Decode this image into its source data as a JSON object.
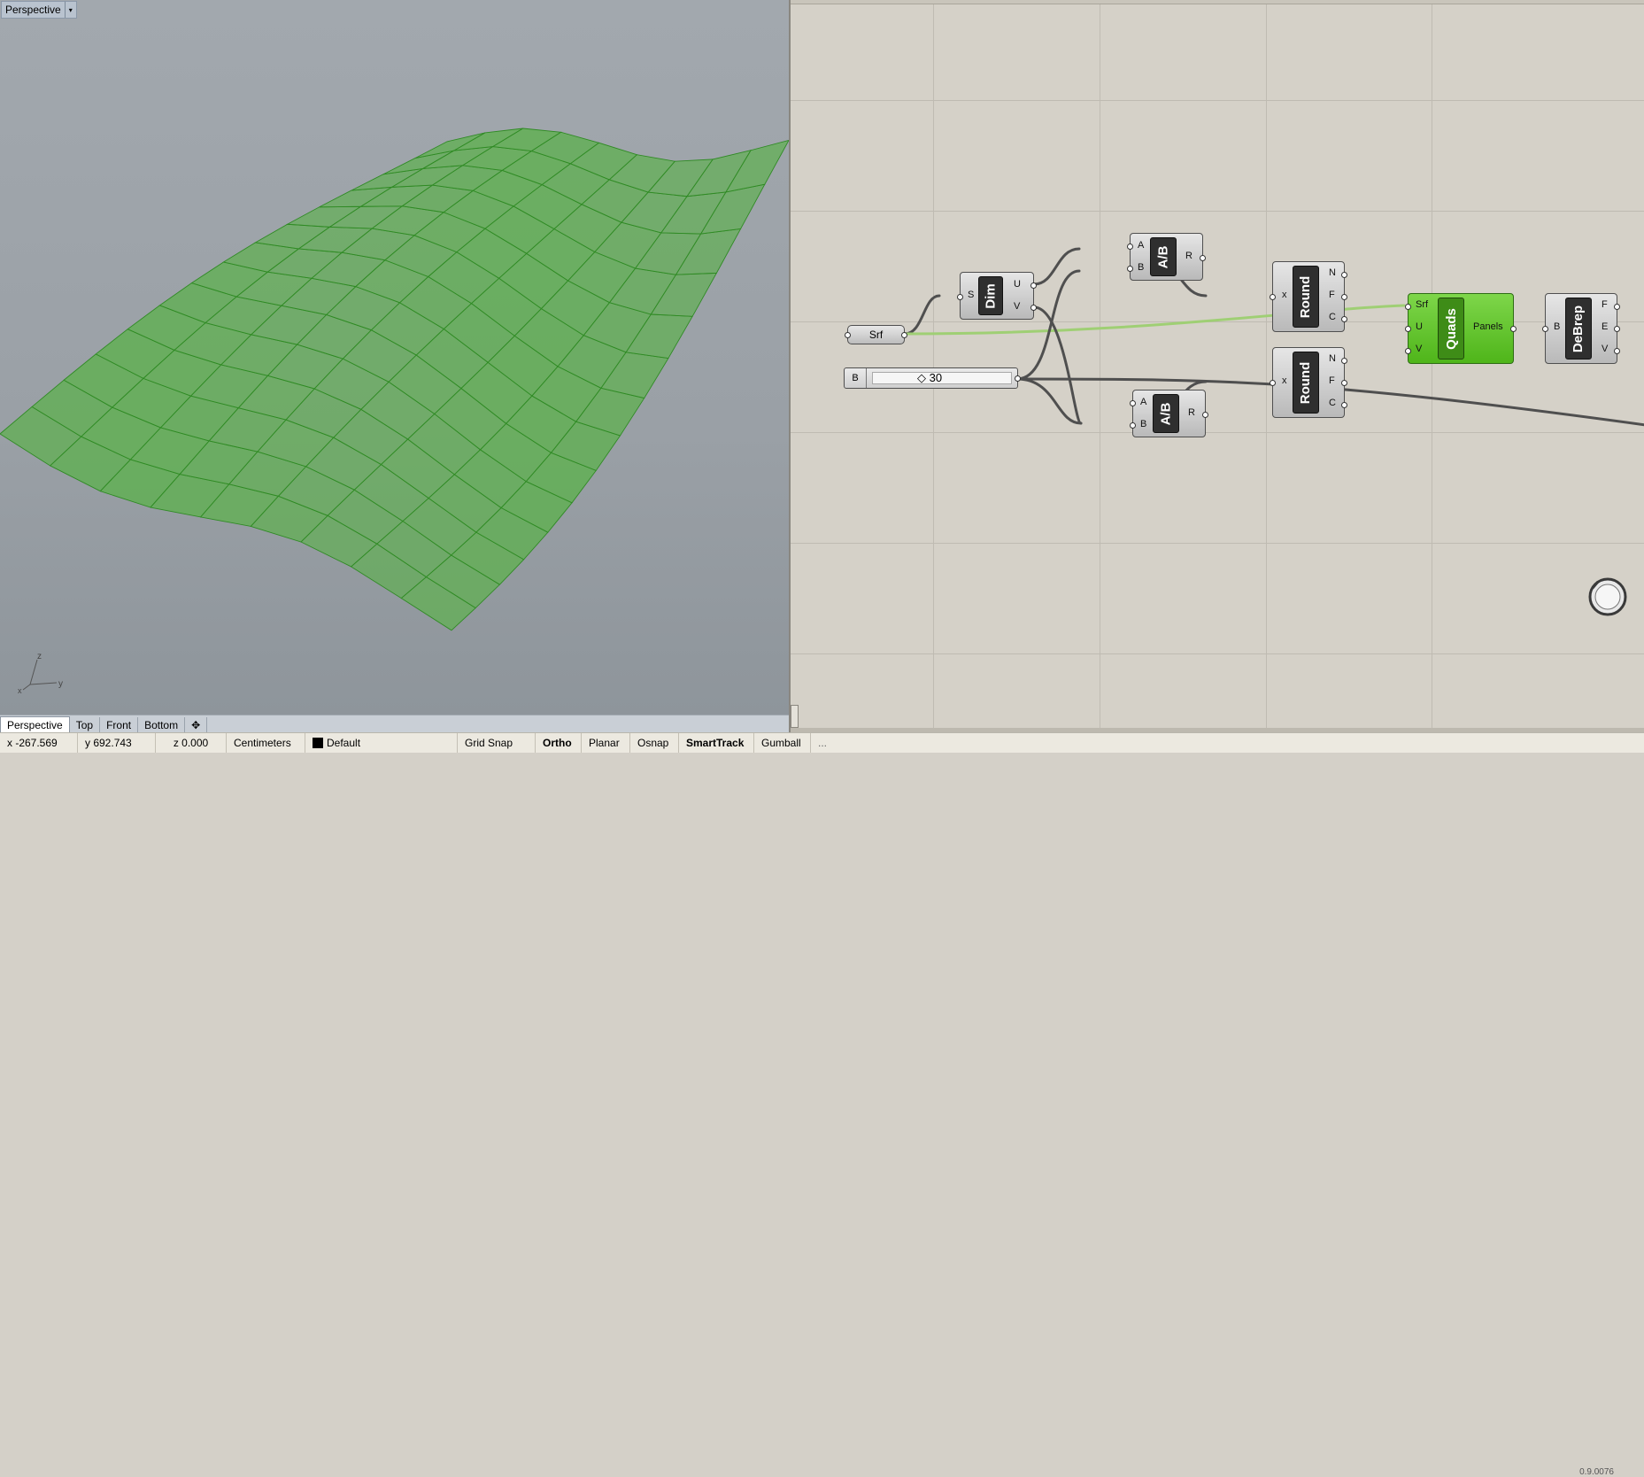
{
  "viewport": {
    "title": "Perspective",
    "menu_arrow": "▾",
    "mesh_color": "#5eb04f",
    "axis": {
      "z": "z",
      "x": "x",
      "y": "y"
    }
  },
  "viewport_tabs": [
    {
      "label": "Perspective",
      "active": true
    },
    {
      "label": "Top"
    },
    {
      "label": "Front"
    },
    {
      "label": "Bottom"
    },
    {
      "label": "✥"
    }
  ],
  "status": {
    "x": "x -267.569",
    "y": "y 692.743",
    "z": "z 0.000",
    "units": "Centimeters",
    "layer": "Default",
    "grid_snap": "Grid Snap",
    "ortho": "Ortho",
    "planar": "Planar",
    "osnap": "Osnap",
    "smarttrack": "SmartTrack",
    "gumball": "Gumball",
    "gh_hint": "..."
  },
  "grasshopper": {
    "version": "0.9.0076",
    "components": {
      "srf_param": {
        "label": "Srf"
      },
      "dim": {
        "name": "Dim",
        "inputs": [
          "S"
        ],
        "outputs": [
          "U",
          "V"
        ]
      },
      "div1": {
        "name": "A/B",
        "inputs": [
          "A",
          "B"
        ],
        "outputs": [
          "R"
        ]
      },
      "div2": {
        "name": "A/B",
        "inputs": [
          "A",
          "B"
        ],
        "outputs": [
          "R"
        ]
      },
      "round1": {
        "name": "Round",
        "inputs": [
          "x"
        ],
        "outputs": [
          "N",
          "F",
          "C"
        ]
      },
      "round2": {
        "name": "Round",
        "inputs": [
          "x"
        ],
        "outputs": [
          "N",
          "F",
          "C"
        ]
      },
      "quads": {
        "name": "Quads",
        "inputs": [
          "Srf",
          "U",
          "V"
        ],
        "outputs": [
          "Panels"
        ],
        "color": "#5cc026"
      },
      "debrep": {
        "name": "DeBrep",
        "inputs": [
          "B"
        ],
        "outputs": [
          "F",
          "E",
          "V"
        ]
      },
      "slider": {
        "label": "B",
        "value": "◇ 30"
      }
    }
  }
}
